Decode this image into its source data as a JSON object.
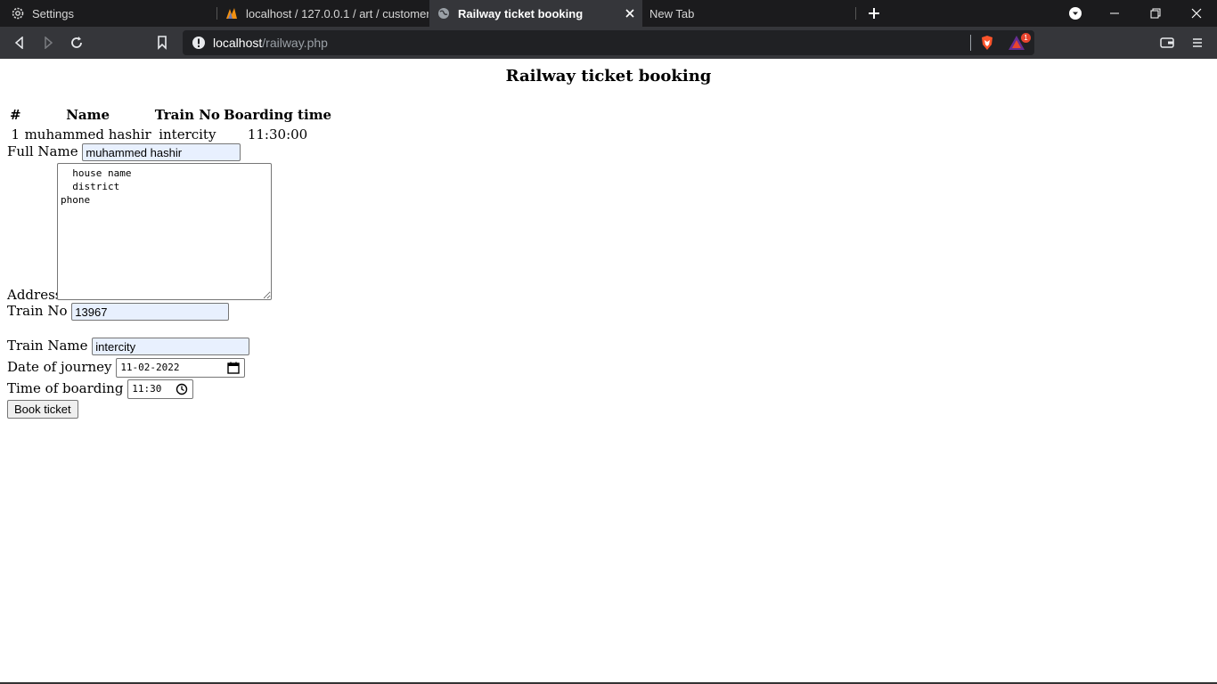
{
  "browser": {
    "tabs": [
      {
        "title": "Settings",
        "icon": "gear-icon"
      },
      {
        "title": "localhost / 127.0.0.1 / art / customer |",
        "icon": "phpmyadmin-icon"
      },
      {
        "title": "Railway ticket booking",
        "icon": "globe-icon",
        "active": true
      },
      {
        "title": "New Tab",
        "icon": ""
      }
    ],
    "address": {
      "host": "localhost",
      "path": "/railway.php"
    },
    "rewards_badge": "1"
  },
  "page": {
    "title": "Railway ticket booking",
    "table": {
      "headers": [
        "#",
        "Name",
        "Train No",
        "Boarding time"
      ],
      "rows": [
        [
          "1",
          "muhammed hashir",
          "intercity",
          "11:30:00"
        ]
      ]
    },
    "form": {
      "full_name_label": "Full Name",
      "full_name_value": "muhammed hashir",
      "address_label": "Address",
      "address_value": "  house name\n  district\nphone",
      "train_no_label": "Train No",
      "train_no_value": "13967",
      "train_name_label": "Train Name",
      "train_name_value": "intercity",
      "date_label": "Date of journey",
      "date_value": "11-02-2022",
      "time_label": "Time of boarding",
      "time_value": "11:30",
      "submit_label": "Book ticket"
    }
  }
}
